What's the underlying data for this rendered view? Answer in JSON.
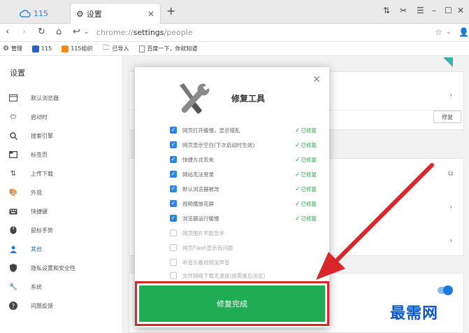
{
  "browser": {
    "tabs": [
      {
        "label": "115",
        "icon": "cloud-icon"
      },
      {
        "label": "设置",
        "icon": "gear-icon"
      }
    ],
    "url_prefix": "chrome://",
    "url_main": "settings",
    "url_suffix": "/people"
  },
  "bookmarks": [
    {
      "label": "管理",
      "icon": "gear-icon",
      "color": "#555555"
    },
    {
      "label": "115",
      "icon": "box-icon",
      "color": "#2563c7"
    },
    {
      "label": "115组织",
      "icon": "box-icon",
      "color": "#f08a1c"
    },
    {
      "label": "已导入",
      "icon": "folder-icon",
      "color": "#777777"
    },
    {
      "label": "百度一下，你就知道",
      "icon": "page-icon",
      "color": "#777777"
    }
  ],
  "sidebar": {
    "title": "设置",
    "items": [
      {
        "label": "默认浏览器",
        "icon": "browser-icon"
      },
      {
        "label": "启动时",
        "icon": "power-icon"
      },
      {
        "label": "搜索引擎",
        "icon": "search-icon"
      },
      {
        "label": "标签页",
        "icon": "tab-icon"
      },
      {
        "label": "上传下载",
        "icon": "updown-icon"
      },
      {
        "label": "外观",
        "icon": "palette-icon"
      },
      {
        "label": "快捷键",
        "icon": "keyboard-icon"
      },
      {
        "label": "鼠标手势",
        "icon": "mouse-icon"
      },
      {
        "label": "其他",
        "icon": "person-icon",
        "active": true
      },
      {
        "label": "隐私设置和安全性",
        "icon": "shield-icon"
      },
      {
        "label": "系统",
        "icon": "wrench-icon"
      },
      {
        "label": "问题反馈",
        "icon": "help-icon"
      }
    ]
  },
  "background": {
    "fix_button": "修复"
  },
  "modal": {
    "title": "修复工具",
    "items": [
      {
        "label": "网页打开缓慢，显示错乱",
        "checked": true,
        "status": "已修复"
      },
      {
        "label": "网页显示空白(下次启动时生效)",
        "checked": true,
        "status": "已修复"
      },
      {
        "label": "快捷方式丢失",
        "checked": true,
        "status": "已修复"
      },
      {
        "label": "网站无法登录",
        "checked": true,
        "status": "已修复"
      },
      {
        "label": "默认浏览器被改",
        "checked": true,
        "status": "已修复"
      },
      {
        "label": "视频播放花屏",
        "checked": true,
        "status": "已修复"
      },
      {
        "label": "浏览器运行缓慢",
        "checked": true,
        "status": "已修复"
      },
      {
        "label": "网页图片不能显示",
        "checked": false,
        "status": ""
      },
      {
        "label": "网页Flash显示有问题",
        "checked": false,
        "status": ""
      },
      {
        "label": "听音乐看视频没声音",
        "checked": false,
        "status": ""
      },
      {
        "label": "文件网络下载无速度(按需重启浏览)",
        "checked": false,
        "status": ""
      }
    ],
    "done_button": "修复完成"
  },
  "colors": {
    "accent": "#2d86e0",
    "success": "#2fa84f",
    "done_button": "#1fac53",
    "highlight": "#d8262b",
    "watermark": "#0a57c6"
  },
  "watermark": "最需网"
}
